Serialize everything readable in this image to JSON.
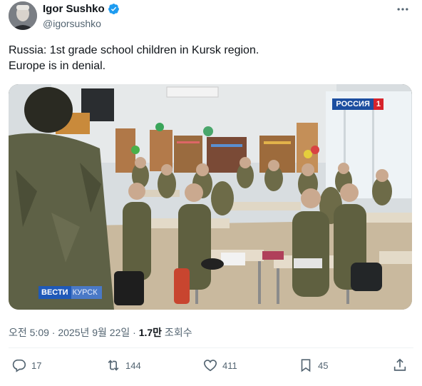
{
  "author": {
    "name": "Igor Sushko",
    "handle": "@igorsushko"
  },
  "tweet": {
    "lines": [
      "Russia: 1st grade school children in Kursk region.",
      "Europe is in denial."
    ]
  },
  "media": {
    "channel_logo": {
      "text": "РОССИЯ",
      "number": "1"
    },
    "news_logo": {
      "text": "ВЕСТИ",
      "region": "КУРСК"
    }
  },
  "meta": {
    "timestamp": "오전 5:09 · 2025년 9월 22일 · ",
    "views_count": "1.7만",
    "views_label": " 조회수"
  },
  "actions": {
    "replies": "17",
    "reposts": "144",
    "likes": "411",
    "bookmarks": "45"
  },
  "colors": {
    "verified": "#1d9bf0",
    "text_primary": "#0f1419",
    "text_secondary": "#536471"
  },
  "icons": [
    "verified-icon",
    "more-icon",
    "reply-icon",
    "repost-icon",
    "like-icon",
    "bookmark-icon",
    "share-icon"
  ]
}
